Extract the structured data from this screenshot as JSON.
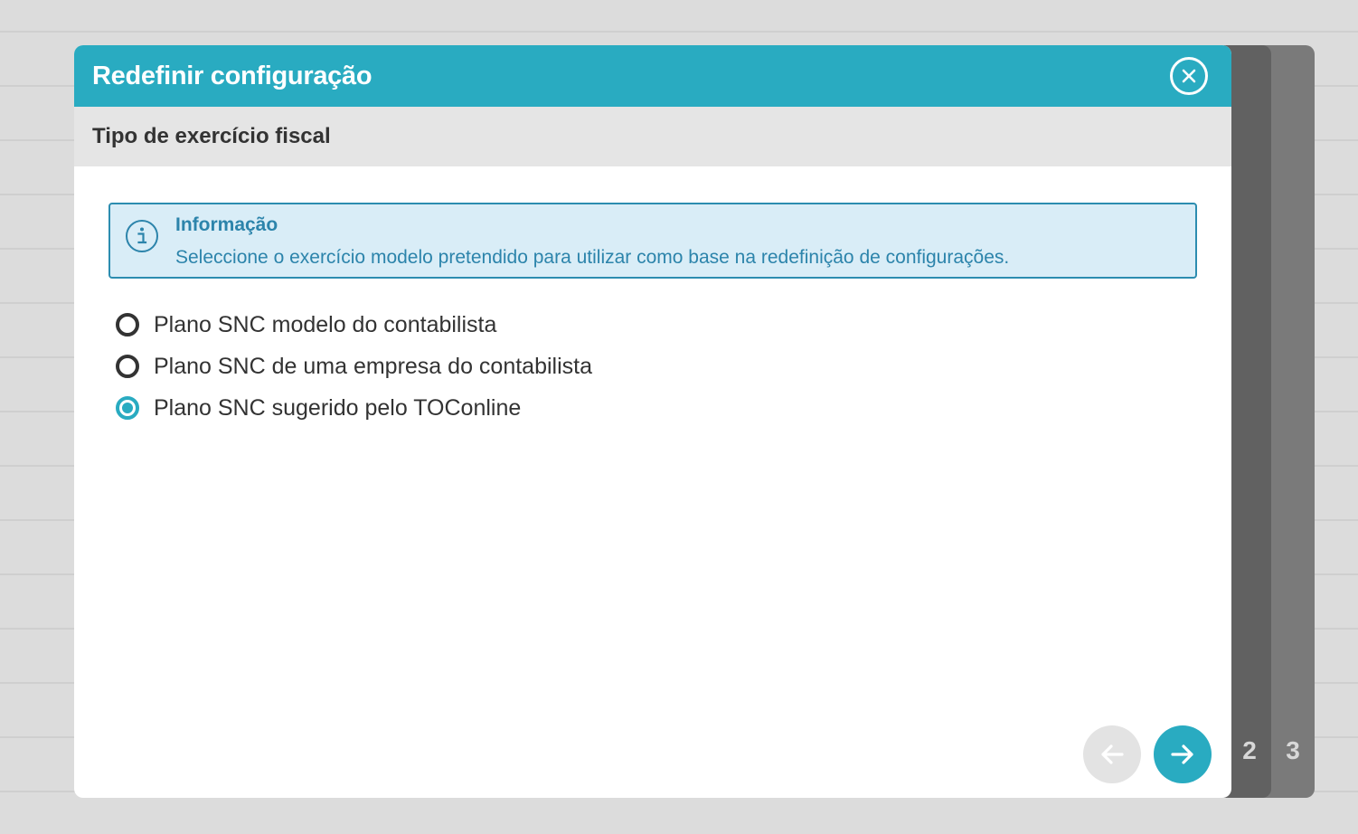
{
  "dialog": {
    "title": "Redefinir configuração",
    "close_icon": "close-circle-icon"
  },
  "subheader": {
    "title": "Tipo de exercício fiscal"
  },
  "info": {
    "icon": "info-icon",
    "title": "Informação",
    "text": "Seleccione o exercício modelo pretendido para utilizar como base na redefinição de configurações."
  },
  "options": [
    {
      "label": "Plano SNC modelo do contabilista",
      "selected": false
    },
    {
      "label": "Plano SNC de uma empresa do contabilista",
      "selected": false
    },
    {
      "label": "Plano SNC sugerido pelo TOConline",
      "selected": true
    }
  ],
  "navigation": {
    "prev_icon": "arrow-left-icon",
    "prev_enabled": false,
    "next_icon": "arrow-right-icon",
    "next_enabled": true
  },
  "steps": [
    "2",
    "3"
  ],
  "colors": {
    "accent": "#29abc1",
    "info_text": "#2c84ab",
    "info_bg": "#d9edf7"
  }
}
